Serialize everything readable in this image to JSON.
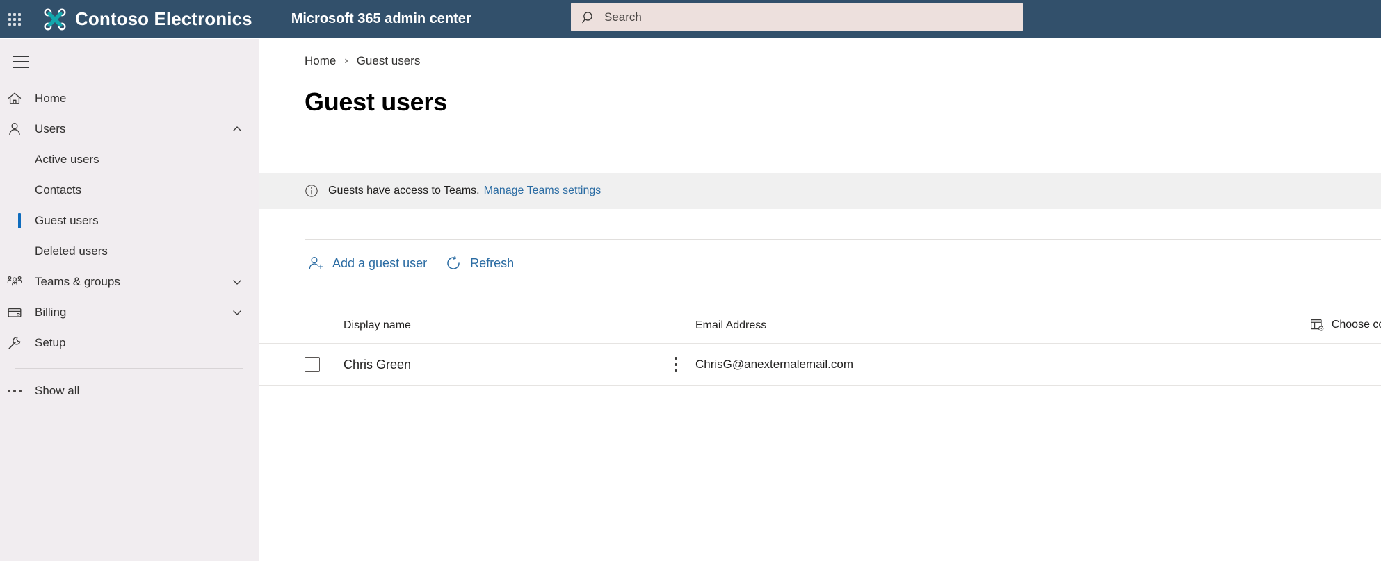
{
  "suite": {
    "waffle_label": "app-launcher",
    "brand_name": "Contoso Electronics",
    "app_name": "Microsoft 365 admin center",
    "brand_logo_color": "#13a8ad",
    "bar_color": "#32506b"
  },
  "search": {
    "placeholder": "Search",
    "value": "",
    "background": "#ede0dd"
  },
  "sidebar": {
    "toggle_label": "hamburger-menu",
    "background": "#f1edf0",
    "selected_accent": "#0f6cbd",
    "items": [
      {
        "label": "Home",
        "icon": "home-icon",
        "type": "top",
        "expanded": false,
        "chevron": ""
      },
      {
        "label": "Users",
        "icon": "user-icon",
        "type": "top",
        "expanded": true,
        "chevron": "up"
      },
      {
        "label": "Active users",
        "type": "sub",
        "selected": false
      },
      {
        "label": "Contacts",
        "type": "sub",
        "selected": false
      },
      {
        "label": "Guest users",
        "type": "sub",
        "selected": true
      },
      {
        "label": "Deleted users",
        "type": "sub",
        "selected": false
      },
      {
        "label": "Teams & groups",
        "icon": "people-icon",
        "type": "top",
        "expanded": false,
        "chevron": "down"
      },
      {
        "label": "Billing",
        "icon": "card-icon",
        "type": "top",
        "expanded": false,
        "chevron": "down"
      },
      {
        "label": "Setup",
        "icon": "wrench-icon",
        "type": "top",
        "expanded": false,
        "chevron": ""
      },
      {
        "label": "Show all",
        "icon": "ellipsis-icon",
        "type": "top",
        "expanded": false,
        "chevron": ""
      }
    ]
  },
  "breadcrumb": {
    "home": "Home",
    "separator": "›",
    "current": "Guest users"
  },
  "page": {
    "title": "Guest users"
  },
  "banner": {
    "icon": "info-icon",
    "text": "Guests have access to Teams.",
    "link_text": "Manage Teams settings",
    "background": "#f0f0f0",
    "link_color": "#2b6ca3"
  },
  "toolbar": {
    "add_guest_label": "Add a guest user",
    "add_guest_icon": "add-user-icon",
    "refresh_label": "Refresh",
    "refresh_icon": "refresh-icon",
    "link_color": "#2b6ca3"
  },
  "table": {
    "columns": {
      "display_name": "Display name",
      "email_address": "Email Address"
    },
    "choose_columns_label": "Choose columns",
    "choose_columns_icon": "choose-columns-icon",
    "rows": [
      {
        "checked": false,
        "display_name": "Chris  Green",
        "email": "ChrisG@anexternalemail.com",
        "kebab": "more-actions-icon"
      }
    ]
  }
}
